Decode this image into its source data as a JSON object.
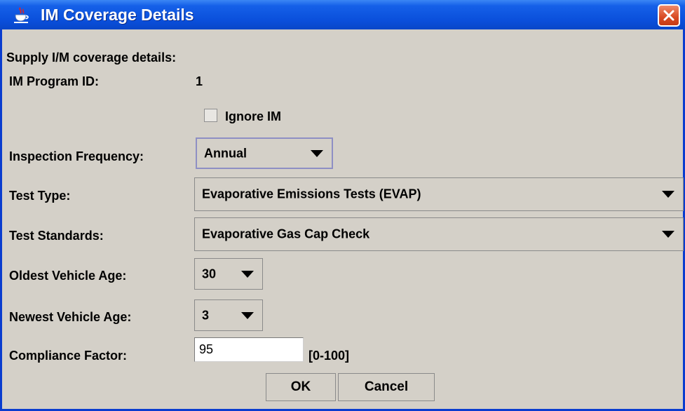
{
  "window": {
    "title": "IM Coverage Details"
  },
  "form": {
    "heading": "Supply I/M coverage details:",
    "program_id_label": "IM Program ID:",
    "program_id_value": "1",
    "ignore_im_label": "Ignore IM",
    "ignore_im_checked": false,
    "inspection_frequency_label": "Inspection Frequency:",
    "inspection_frequency_value": "Annual",
    "test_type_label": "Test Type:",
    "test_type_value": "Evaporative Emissions Tests (EVAP)",
    "test_standards_label": "Test Standards:",
    "test_standards_value": "Evaporative Gas Cap Check",
    "oldest_age_label": "Oldest Vehicle Age:",
    "oldest_age_value": "30",
    "newest_age_label": "Newest Vehicle Age:",
    "newest_age_value": "3",
    "compliance_label": "Compliance Factor:",
    "compliance_value": "95",
    "compliance_range": "[0-100]"
  },
  "buttons": {
    "ok": "OK",
    "cancel": "Cancel"
  },
  "colors": {
    "titlebar": "#0a4fdb",
    "close": "#d84a22",
    "panel": "#d4d0c8"
  },
  "icons": {
    "app": "java-cup-icon",
    "close": "close-icon"
  }
}
